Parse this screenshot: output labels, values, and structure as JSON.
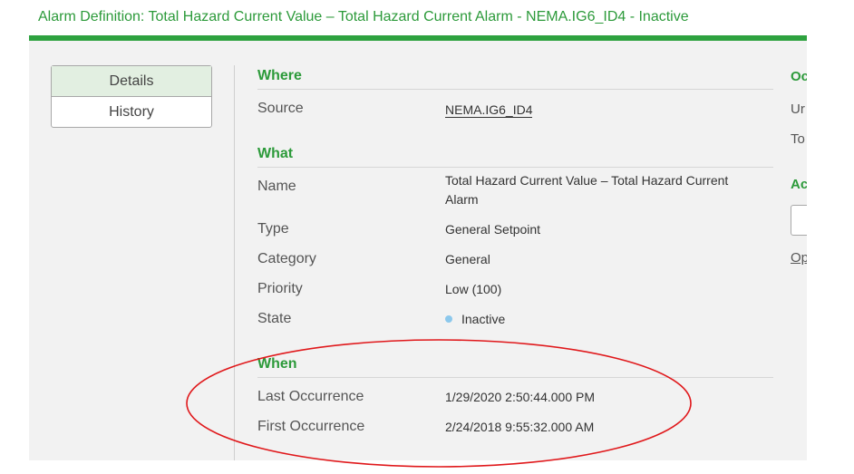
{
  "header": {
    "title": "Alarm Definition: Total Hazard Current Value – Total Hazard Current Alarm - NEMA.IG6_ID4 - Inactive"
  },
  "tabs": [
    {
      "label": "Details",
      "active": true
    },
    {
      "label": "History",
      "active": false
    }
  ],
  "where": {
    "heading": "Where",
    "source_label": "Source",
    "source_value": "NEMA.IG6_ID4"
  },
  "what": {
    "heading": "What",
    "name_label": "Name",
    "name_value_line1": "Total Hazard Current Value – Total Hazard Current",
    "name_value_line2": "Alarm",
    "type_label": "Type",
    "type_value": "General Setpoint",
    "category_label": "Category",
    "category_value": "General",
    "priority_label": "Priority",
    "priority_value": "Low (100)",
    "state_label": "State",
    "state_value": "Inactive"
  },
  "when": {
    "heading": "When",
    "last_label": "Last Occurrence",
    "last_value": "1/29/2020 2:50:44.000 PM",
    "first_label": "First Occurrence",
    "first_value": "2/24/2018 9:55:32.000 AM"
  },
  "right_column": {
    "heading1": "Oc",
    "row1": "Ur",
    "row2": "To",
    "heading2": "Ac",
    "link": "Op"
  },
  "colors": {
    "accent": "#2ea23f",
    "state_dot": "#8cc8ec",
    "annotation": "#e0181b"
  }
}
